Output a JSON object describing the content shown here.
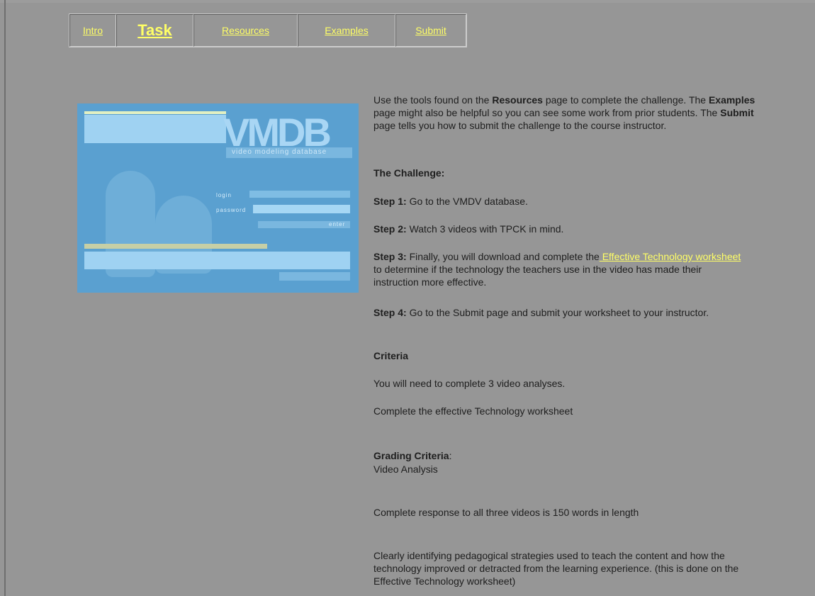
{
  "nav": {
    "tabs": [
      {
        "label": "Intro"
      },
      {
        "label": "Task",
        "active": true
      },
      {
        "label": "Resources"
      },
      {
        "label": "Examples"
      },
      {
        "label": "Submit"
      }
    ]
  },
  "hero": {
    "logo_text": "VMDB",
    "tagline": "video modeling database",
    "login_label": "login",
    "password_label": "password",
    "enter_label": "enter"
  },
  "intro": {
    "p1_a": "Use the tools found on the ",
    "p1_b": "Resources",
    "p1_c": " page to complete the challenge. The ",
    "p1_d": "Examples",
    "p1_e": " page might also be helpful so you can see some work from prior students. The ",
    "p1_f": "Submit",
    "p1_g": " page tells you how to submit the challenge to the course instructor."
  },
  "challenge": {
    "heading": "The Challenge:",
    "step1_label": "Step 1:",
    "step1_text": " Go to the VMDV database.",
    "step2_label": "Step 2:",
    "step2_text": " Watch 3 videos with TPCK in mind.",
    "step3_label": "Step 3:",
    "step3_text_a": " Finally, you will download and complete the",
    "step3_link": " Effective Technology worksheet",
    "step3_text_b": " to determine if the technology the teachers use in the video has made their instruction more effective.",
    "step4_label": "Step 4:",
    "step4_text": " Go to the Submit page and submit your worksheet to your instructor."
  },
  "criteria": {
    "heading": "Criteria",
    "line1": "You will need to complete 3 video analyses.",
    "line2": "Complete the effective Technology worksheet"
  },
  "grading": {
    "heading": "Grading Criteria",
    "colon": ":",
    "subheading": "Video Analysis",
    "line1": "Complete response to all three videos is 150 words in length",
    "line2": "Clearly identifying pedagogical strategies used to teach the content and how the technology improved or detracted from the learning experience. (this is done on the Effective Technology worksheet)"
  }
}
